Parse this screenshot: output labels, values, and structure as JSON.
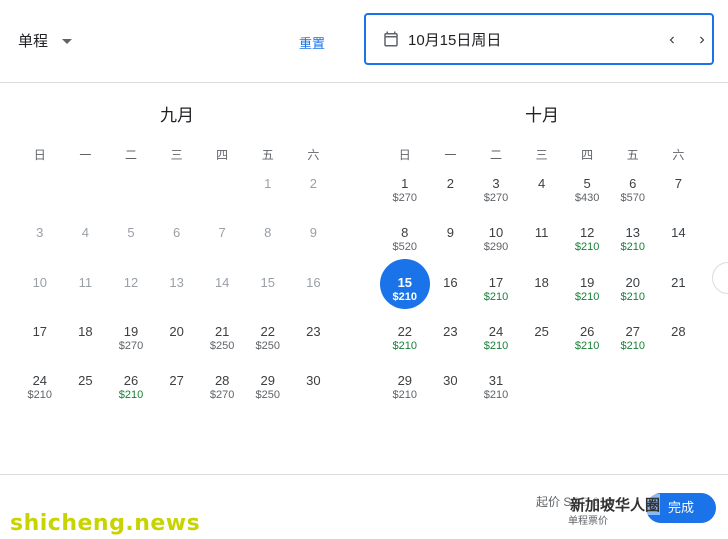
{
  "header": {
    "trip_type": "单程",
    "reset_label": "重置",
    "date_value": "10月15日周日"
  },
  "calendar": {
    "weekdays": [
      "日",
      "一",
      "二",
      "三",
      "四",
      "五",
      "六"
    ],
    "months": [
      {
        "title": "九月",
        "leading_blanks": 5,
        "days": [
          {
            "d": "1",
            "p": "",
            "past": true
          },
          {
            "d": "2",
            "p": "",
            "past": true
          },
          {
            "d": "3",
            "p": "",
            "past": true
          },
          {
            "d": "4",
            "p": "",
            "past": true
          },
          {
            "d": "5",
            "p": "",
            "past": true
          },
          {
            "d": "6",
            "p": "",
            "past": true
          },
          {
            "d": "7",
            "p": "",
            "past": true
          },
          {
            "d": "8",
            "p": "",
            "past": true
          },
          {
            "d": "9",
            "p": "",
            "past": true
          },
          {
            "d": "10",
            "p": "",
            "past": true
          },
          {
            "d": "11",
            "p": "",
            "past": true
          },
          {
            "d": "12",
            "p": "",
            "past": true
          },
          {
            "d": "13",
            "p": "",
            "past": true
          },
          {
            "d": "14",
            "p": "",
            "past": true
          },
          {
            "d": "15",
            "p": "",
            "past": true
          },
          {
            "d": "16",
            "p": "",
            "past": true
          },
          {
            "d": "17",
            "p": ""
          },
          {
            "d": "18",
            "p": ""
          },
          {
            "d": "19",
            "p": "$270"
          },
          {
            "d": "20",
            "p": ""
          },
          {
            "d": "21",
            "p": "$250"
          },
          {
            "d": "22",
            "p": "$250"
          },
          {
            "d": "23",
            "p": ""
          },
          {
            "d": "24",
            "p": "$210"
          },
          {
            "d": "25",
            "p": ""
          },
          {
            "d": "26",
            "p": "$210",
            "low": true
          },
          {
            "d": "27",
            "p": ""
          },
          {
            "d": "28",
            "p": "$270"
          },
          {
            "d": "29",
            "p": "$250"
          },
          {
            "d": "30",
            "p": ""
          }
        ]
      },
      {
        "title": "十月",
        "leading_blanks": 0,
        "days": [
          {
            "d": "1",
            "p": "$270"
          },
          {
            "d": "2",
            "p": ""
          },
          {
            "d": "3",
            "p": "$270"
          },
          {
            "d": "4",
            "p": ""
          },
          {
            "d": "5",
            "p": "$430"
          },
          {
            "d": "6",
            "p": "$570"
          },
          {
            "d": "7",
            "p": ""
          },
          {
            "d": "8",
            "p": "$520"
          },
          {
            "d": "9",
            "p": ""
          },
          {
            "d": "10",
            "p": "$290"
          },
          {
            "d": "11",
            "p": ""
          },
          {
            "d": "12",
            "p": "$210",
            "low": true
          },
          {
            "d": "13",
            "p": "$210",
            "low": true
          },
          {
            "d": "14",
            "p": ""
          },
          {
            "d": "15",
            "p": "$210",
            "sel": true
          },
          {
            "d": "16",
            "p": ""
          },
          {
            "d": "17",
            "p": "$210",
            "low": true
          },
          {
            "d": "18",
            "p": ""
          },
          {
            "d": "19",
            "p": "$210",
            "low": true
          },
          {
            "d": "20",
            "p": "$210",
            "low": true
          },
          {
            "d": "21",
            "p": ""
          },
          {
            "d": "22",
            "p": "$210",
            "low": true
          },
          {
            "d": "23",
            "p": ""
          },
          {
            "d": "24",
            "p": "$210",
            "low": true
          },
          {
            "d": "25",
            "p": ""
          },
          {
            "d": "26",
            "p": "$210",
            "low": true
          },
          {
            "d": "27",
            "p": "$210",
            "low": true
          },
          {
            "d": "28",
            "p": ""
          },
          {
            "d": "29",
            "p": "$210"
          },
          {
            "d": "30",
            "p": ""
          },
          {
            "d": "31",
            "p": "$210"
          }
        ]
      }
    ]
  },
  "footer": {
    "from_label": "起价",
    "price_partial": "SGD 210",
    "sub_label": "单程票价",
    "done_label": "完成"
  },
  "watermarks": {
    "left": "shicheng.news",
    "right": "新加坡华人圈"
  },
  "colors": {
    "accent": "#1a73e8",
    "low_price": "#188038"
  },
  "icons": [
    "calendar-icon",
    "chevron-left-icon",
    "chevron-right-icon",
    "dropdown-caret-icon"
  ]
}
